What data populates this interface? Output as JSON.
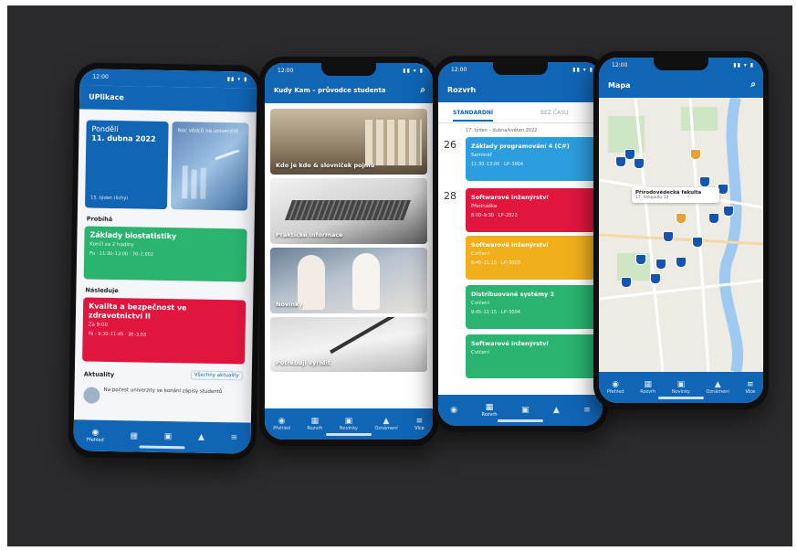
{
  "phones": {
    "home": {
      "time": "12:00",
      "title": "UPlikace",
      "date_day": "Pondělí",
      "date": "11. dubna 2022",
      "week": "15. týden (lichý)",
      "promo": "Noc vědců na univerzitě",
      "sections": {
        "current": "Probíhá",
        "next": "Následuje",
        "news": "Aktuality",
        "news_all": "Všechny aktuality"
      },
      "current_card": {
        "title": "Základy biostatistiky",
        "subtitle": "Končí za 2 hodiny",
        "meta": "Po · 11:30–13:00 · 70–2.002"
      },
      "next_card": {
        "title": "Kvalita a bezpečnost ve zdravotnictví II",
        "subtitle": "Za 9:00",
        "meta": "Pá · 9:30–11:45 · 3E–3.03"
      },
      "news_item": "Na počest univerzity se konání zápisy studentů",
      "nav": [
        "Přehled",
        "",
        "",
        "",
        ""
      ]
    },
    "guide": {
      "time": "12:00",
      "title": "Kudy Kam – průvodce studenta",
      "cards": [
        "Kdo je kdo & slovníček pojmů",
        "Praktické informace",
        "Novinky",
        "Potřebuji vyřídit"
      ],
      "nav": [
        "Přehled",
        "Rozvrh",
        "Novinky",
        "Oznámení",
        "Více"
      ]
    },
    "schedule": {
      "time": "12:00",
      "title": "Rozvrh",
      "tabs": [
        "STANDARDNÍ",
        "BEZ ČASU"
      ],
      "week_label": "17. týden – dubna/květen 2022",
      "days": [
        "26",
        "28"
      ],
      "entries": [
        {
          "title": "Základy programování 4 (C#)",
          "kind": "Seminář",
          "meta": "11:30–13:00 · LP–3004",
          "color": "#2c9ee0"
        },
        {
          "title": "Softwarové inženýrství",
          "kind": "Přednáška",
          "meta": "8:00–9:30 · LP–2023",
          "color": "#e0163f"
        },
        {
          "title": "Softwarové inženýrství",
          "kind": "Cvičení",
          "meta": "9:45–11:15 · LP–3003",
          "color": "#f0b01c"
        },
        {
          "title": "Distribuované systémy 2",
          "kind": "Cvičení",
          "meta": "9:45–11:15 · LP–3004",
          "color": "#2ab46f"
        },
        {
          "title": "Softwarové inženýrství",
          "kind": "Cvičení",
          "meta": "",
          "color": "#2ab46f"
        }
      ]
    },
    "map": {
      "time": "12:00",
      "title": "Mapa",
      "popup_title": "Přírodovědecká fakulta",
      "popup_sub": "17. listopadu 12",
      "nav": [
        "Přehled",
        "Rozvrh",
        "Novinky",
        "Oznámení",
        "Více"
      ]
    }
  },
  "colors": {
    "brand": "#1065b5",
    "green": "#2ab46f",
    "red": "#e0163f",
    "yellow": "#f0b01c",
    "blue": "#2c9ee0"
  }
}
